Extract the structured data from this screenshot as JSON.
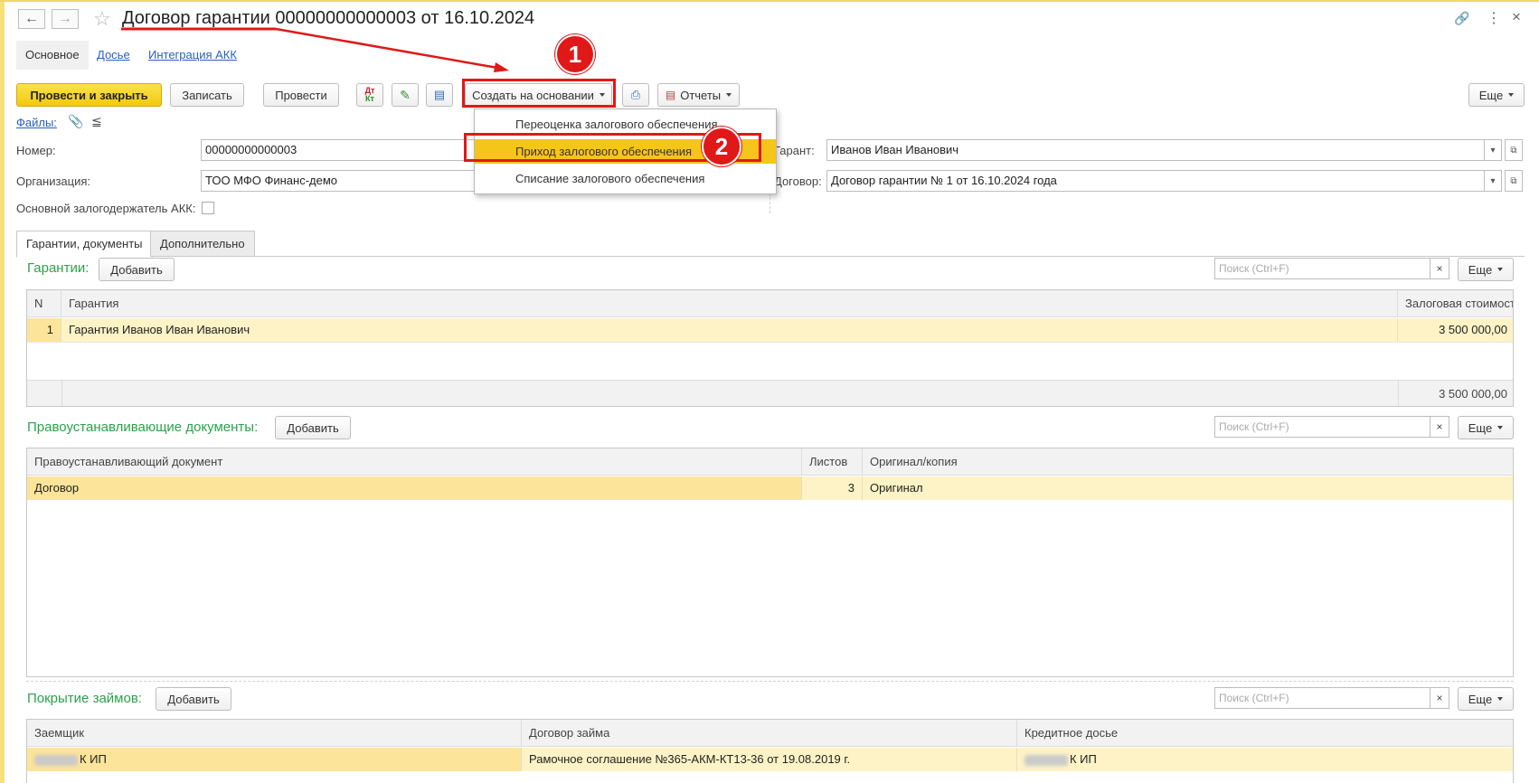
{
  "window": {
    "title": "Договор гарантии 00000000000003 от 16.10.2024"
  },
  "tabs": [
    {
      "label": "Основное"
    },
    {
      "label": "Досье"
    },
    {
      "label": "Интеграция АКК"
    }
  ],
  "toolbar": {
    "post_close": "Провести и закрыть",
    "save": "Записать",
    "post": "Провести",
    "create_based": "Создать на основании",
    "reports": "Отчеты",
    "more": "Еще"
  },
  "files": {
    "label": "Файлы:"
  },
  "dropdown": {
    "items": [
      {
        "label": "Переоценка залогового обеспечения"
      },
      {
        "label": "Приход залогового обеспечения"
      },
      {
        "label": "Списание залогового обеспечения"
      }
    ]
  },
  "annotations": {
    "marker1": "1",
    "marker2": "2"
  },
  "form": {
    "number_label": "Номер:",
    "number_value": "00000000000003",
    "org_label": "Организация:",
    "org_value": "ТОО МФО Финанс-демо",
    "main_holder_label": "Основной залогодержатель АКК:",
    "guarantor_label": "Гарант:",
    "guarantor_value": "Иванов Иван Иванович",
    "contract_label": "Договор:",
    "contract_value": "Договор гарантии № 1 от 16.10.2024 года"
  },
  "page_tabs": [
    {
      "label": "Гарантии, документы"
    },
    {
      "label": "Дополнительно"
    }
  ],
  "guarantees": {
    "title": "Гарантии:",
    "add": "Добавить",
    "search_placeholder": "Поиск (Ctrl+F)",
    "clear": "×",
    "more": "Еще",
    "columns": [
      "N",
      "Гарантия",
      "Залоговая стоимость"
    ],
    "rows": [
      {
        "n": "1",
        "name": "Гарантия Иванов Иван Иванович",
        "value": "3 500 000,00"
      }
    ],
    "total": "3 500 000,00"
  },
  "title_docs": {
    "title": "Правоустанавливающие документы:",
    "add": "Добавить",
    "search_placeholder": "Поиск (Ctrl+F)",
    "clear": "×",
    "more": "Еще",
    "columns": [
      "Правоустанавливающий документ",
      "Листов",
      "Оригинал/копия"
    ],
    "rows": [
      {
        "doc": "Договор",
        "sheets": "3",
        "kind": "Оригинал"
      }
    ]
  },
  "loans": {
    "title": "Покрытие займов:",
    "add": "Добавить",
    "search_placeholder": "Поиск (Ctrl+F)",
    "clear": "×",
    "more": "Еще",
    "columns": [
      "Заемщик",
      "Договор займа",
      "Кредитное досье"
    ],
    "rows": [
      {
        "borrower": "К ИП",
        "contract": "Рамочное соглашение №365-АКМ-КТ13-36 от 19.08.2019 г.",
        "dossier": "К ИП"
      }
    ]
  },
  "colors": {
    "primary_button": "#f4cf1c",
    "section_title": "#2aa34a",
    "annotation_red": "#e01818",
    "selected_row": "#fdf3c6",
    "link": "#2a5ec2"
  }
}
